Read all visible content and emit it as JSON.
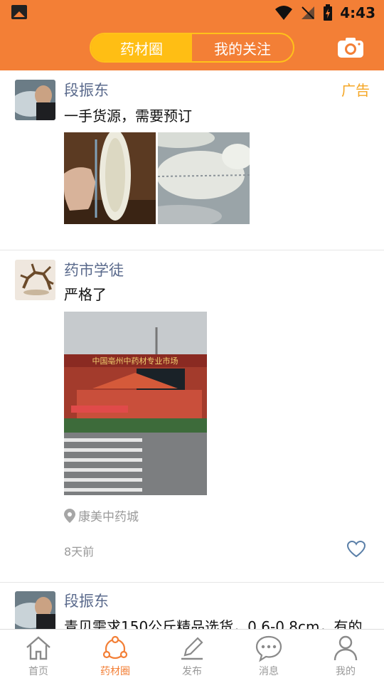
{
  "status": {
    "time": "4:43"
  },
  "header": {
    "tabs": [
      {
        "label": "药材圈",
        "active": true
      },
      {
        "label": "我的关注",
        "active": false
      }
    ]
  },
  "posts": [
    {
      "username": "段振东",
      "ad_label": "广告",
      "text": "一手货源，需要预订"
    },
    {
      "username": "药市学徒",
      "text": "严格了",
      "photo_sign": "中国亳州中药材专业市场",
      "location": "康美中药城",
      "time": "8天前"
    },
    {
      "username": "段振东",
      "text": "青贝需求150公斤精品选货，0.6-0.8cm，有的"
    }
  ],
  "tabbar": [
    {
      "label": "首页",
      "icon": "home-icon",
      "active": false
    },
    {
      "label": "药材圈",
      "icon": "share-circle-icon",
      "active": true
    },
    {
      "label": "发布",
      "icon": "pen-icon",
      "active": false
    },
    {
      "label": "消息",
      "icon": "chat-bubble-icon",
      "active": false
    },
    {
      "label": "我的",
      "icon": "person-icon",
      "active": false
    }
  ],
  "colors": {
    "brand_orange": "#f37f36",
    "segment_yellow": "#ffbe14",
    "username_blue": "#5a6a8c",
    "ad_orange": "#f5a623"
  }
}
